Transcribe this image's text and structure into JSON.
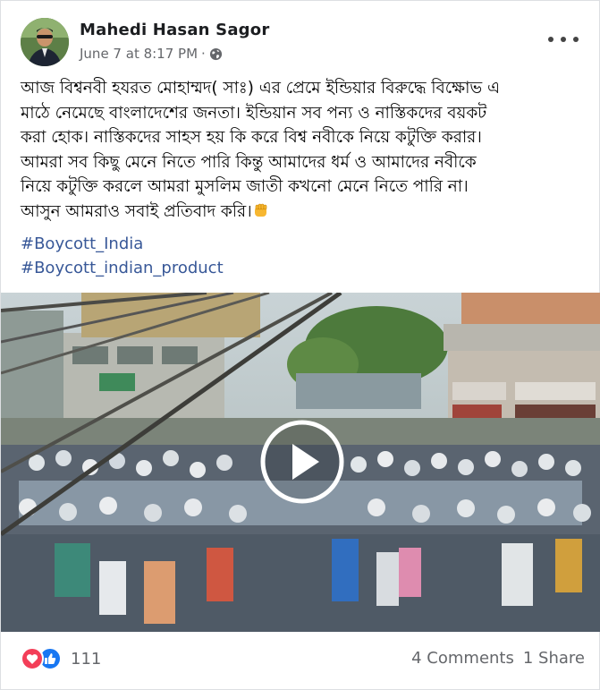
{
  "post": {
    "author": "Mahedi Hasan Sagor",
    "date": "June 7 at 8:17 PM",
    "separator": "·",
    "privacy_icon": "globe-icon",
    "more_icon": "more-options-icon",
    "body_lines": [
      "আজ বিশ্বনবী হযরত মোহাম্মদ( সাঃ) এর প্রেমে ইন্ডিয়ার বিরুদ্ধে বিক্ষোভ এ",
      "মাঠে নেমেছে বাংলাদেশের জনতা। ইন্ডিয়ান সব পন্য ও নাস্তিকদের বয়কট",
      "করা হোক।  নাস্তিকদের সাহস হয় কি করে বিশ্ব নবীকে নিয়ে কটুক্তি করার।",
      "আমরা সব কিছু মেনে নিতে পারি কিন্তু আমাদের ধর্ম ও আমাদের নবীকে",
      "নিয়ে কটুক্তি করলে আমরা মুসলিম জাতী কখনো মেনে নিতে পারি না।",
      "আসুন আমরাও সবাই প্রতিবাদ করি।"
    ],
    "emoji": "fist-emoji",
    "hashtags": [
      "#Boycott_India",
      "#Boycott_indian_product"
    ]
  },
  "video": {
    "play_icon": "play-icon"
  },
  "footer": {
    "reaction_icons": [
      "love-reaction-icon",
      "like-reaction-icon"
    ],
    "reaction_count": "111",
    "comments": "4 Comments",
    "shares": "1 Share"
  },
  "colors": {
    "link": "#385898",
    "secondary_text": "#65676b",
    "love": "#f33e58",
    "like": "#1877f2"
  }
}
